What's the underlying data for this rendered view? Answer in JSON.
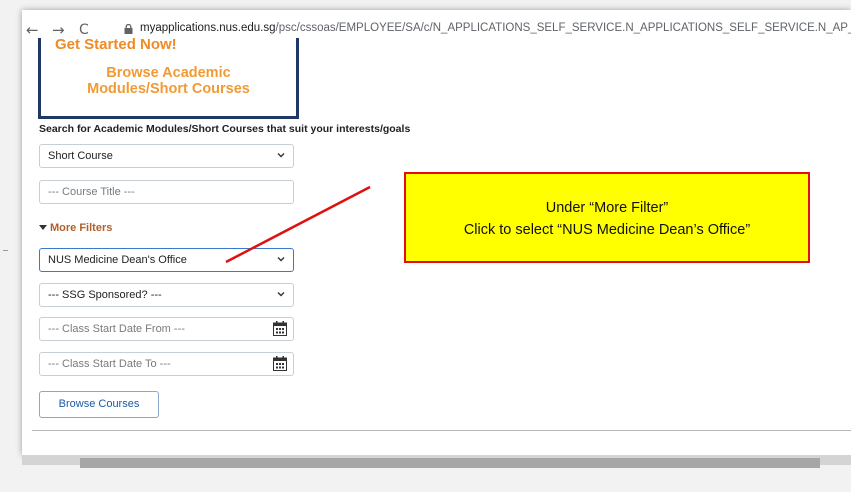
{
  "browser": {
    "back": "←",
    "forward": "→",
    "reload": "C",
    "url_host": "myapplications.nus.edu.sg",
    "url_path": "/psc/cssoas/EMPLOYEE/SA/c/N_APPLICATIONS_SELF_SERVICE.N_APPLICATIONS_SELF_SERVICE.N_AP_SC_BRWSCAT_FL.GBL?Page=N_AP_SC_BRWS"
  },
  "banner": {
    "partial_title": "Get Started Now!",
    "line1": "Browse Academic",
    "line2": "Modules/Short Courses"
  },
  "search": {
    "label": "Search for Academic Modules/Short Courses that suit your interests/goals",
    "course_type": "Short Course",
    "course_title_placeholder": "--- Course Title ---",
    "more_filters": "More Filters",
    "department": "NUS Medicine Dean's Office",
    "ssg": "--- SSG Sponsored? ---",
    "start_from": "--- Class Start Date From ---",
    "start_to": "--- Class Start Date To ---",
    "browse_button": "Browse Courses"
  },
  "callout": {
    "line1": "Under “More Filter”",
    "line2": "Click to select “NUS Medicine Dean’s Office”"
  }
}
